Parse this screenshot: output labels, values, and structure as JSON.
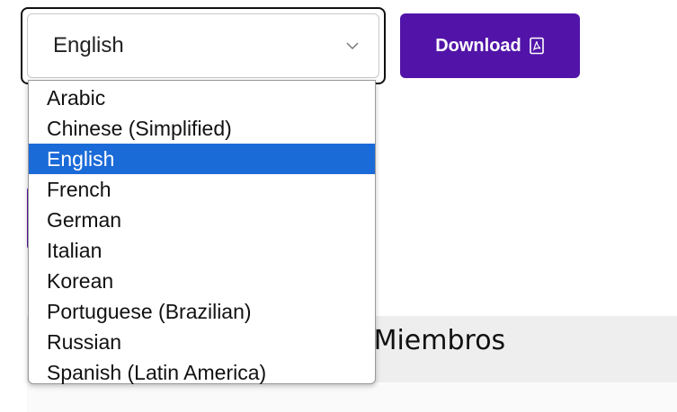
{
  "language_select": {
    "value": "English",
    "options": [
      "Arabic",
      "Chinese (Simplified)",
      "English",
      "French",
      "German",
      "Italian",
      "Korean",
      "Portuguese (Brazilian)",
      "Russian",
      "Spanish (Latin America)"
    ],
    "selected_index": 2
  },
  "download_button": {
    "label": "Download",
    "icon": "pdf-file-icon"
  },
  "background": {
    "banner_title": "o para Miembros"
  },
  "colors": {
    "brand_purple": "#5214a8",
    "selected_option": "#1a6ad8",
    "banner_bg": "#eeeeee"
  }
}
